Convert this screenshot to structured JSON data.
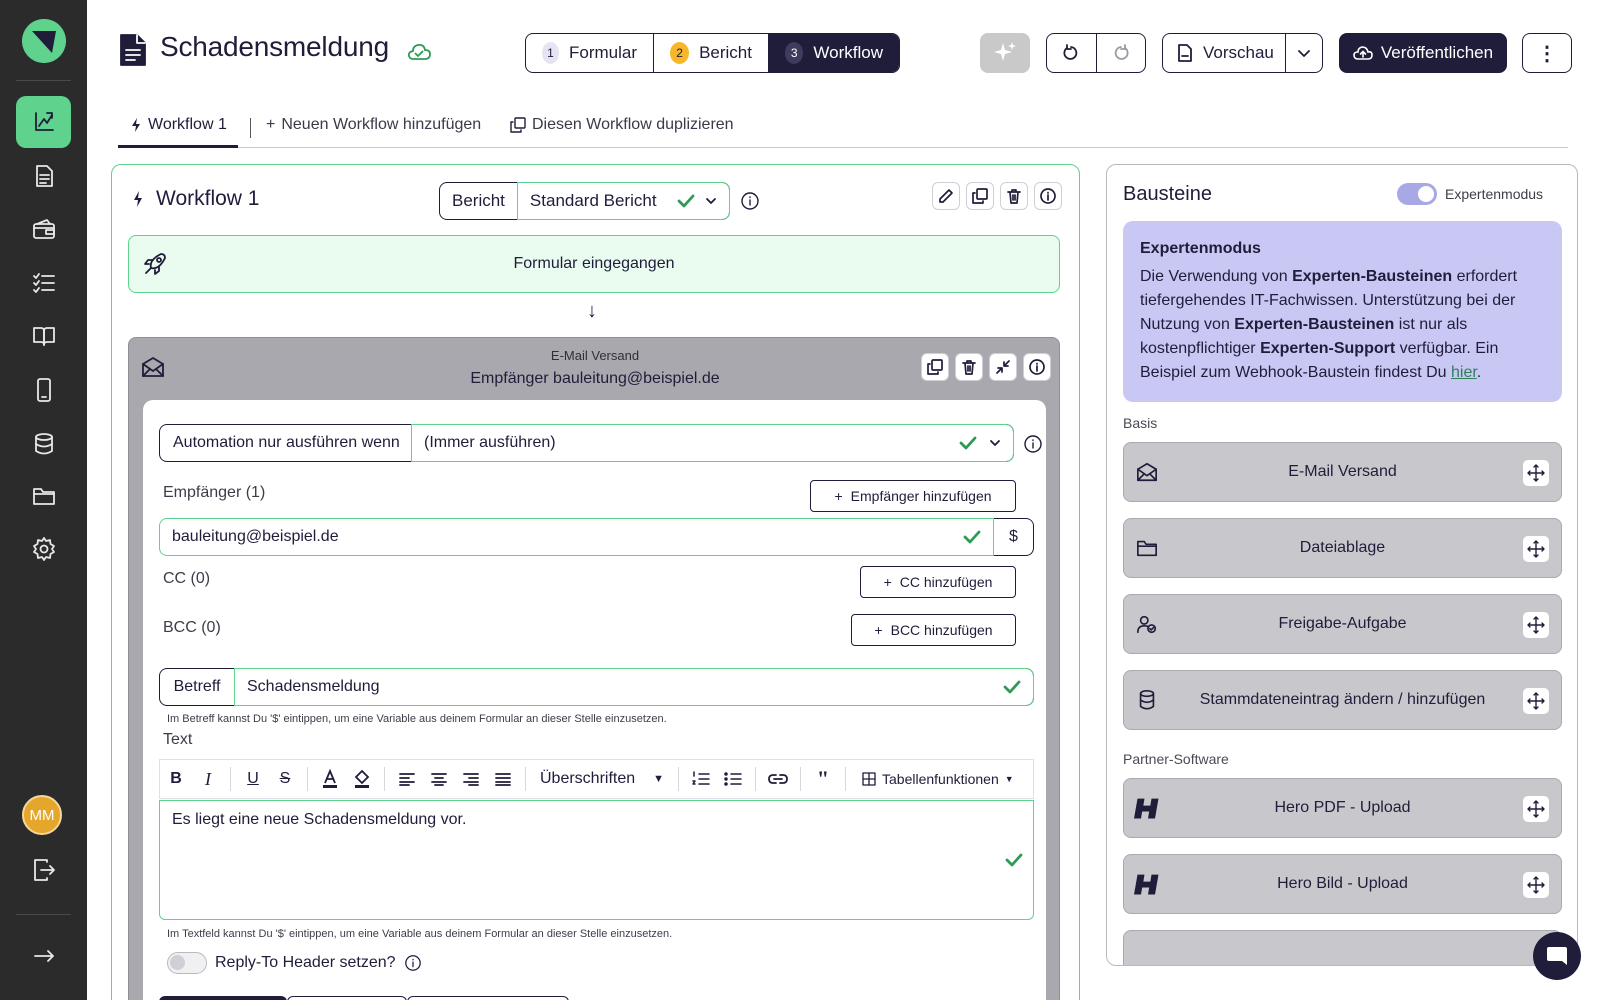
{
  "header": {
    "title": "Schadensmeldung",
    "steps": [
      {
        "num": "1",
        "label": "Formular"
      },
      {
        "num": "2",
        "label": "Bericht"
      },
      {
        "num": "3",
        "label": "Workflow"
      }
    ],
    "preview_label": "Vorschau",
    "publish_label": "Veröffentlichen",
    "more_label": "⋮"
  },
  "sidebar": {
    "items": [
      "workflow-icon",
      "document-icon",
      "wallet-icon",
      "checklist-icon",
      "book-icon",
      "phone-icon",
      "database-icon",
      "folder-icon",
      "gear-icon"
    ],
    "avatar_initials": "MM"
  },
  "tabs": {
    "workflow1": "Workflow 1",
    "add": "Neuen Workflow hinzufügen",
    "duplicate": "Diesen Workflow duplizieren"
  },
  "workflow": {
    "title": "Workflow 1",
    "report_label": "Bericht",
    "report_value": "Standard Bericht",
    "trigger": "Formular eingegangen",
    "arrow": "↓",
    "email": {
      "type": "E-Mail Versand",
      "summary": "Empfänger bauleitung@beispiel.de",
      "automation_label": "Automation nur ausführen wenn",
      "automation_value": "(Immer ausführen)",
      "recipients_label": "Empfänger (1)",
      "add_recipient": "Empfänger hinzufügen",
      "recipient": "bauleitung@beispiel.de",
      "dollar": "$",
      "cc_label": "CC (0)",
      "add_cc": "CC hinzufügen",
      "bcc_label": "BCC (0)",
      "add_bcc": "BCC hinzufügen",
      "subject_label": "Betreff",
      "subject_value": "Schadensmeldung",
      "subject_hint": "Im Betreff kannst Du '$' eintippen, um eine Variable aus deinem Formular an dieser Stelle einzusetzen.",
      "text_label": "Text",
      "toolbar_headings": "Überschriften",
      "toolbar_table": "Tabellenfunktionen",
      "body_text": "Es liegt eine neue Schadensmeldung vor.",
      "text_hint": "Im Textfeld kannst Du '$' eintippen, um eine Variable aus deinem Formular an dieser Stelle einzusetzen.",
      "reply_to": "Reply-To Header setzen?"
    }
  },
  "bausteine": {
    "title": "Bausteine",
    "expert_toggle": "Expertenmodus",
    "expert_box": {
      "heading": "Expertenmodus",
      "t1": "Die Verwendung von ",
      "b1": "Experten-Bausteinen",
      "t2": " erfordert tiefergehendes IT-Fachwissen. Unterstützung bei der Nutzung von ",
      "b2": "Experten-Bausteinen",
      "t3": " ist nur als kostenpflichtiger ",
      "b3": "Experten-Support",
      "t4": " verfügbar. Ein Beispiel zum Webhook-Baustein findest Du ",
      "link": "hier",
      "t5": "."
    },
    "basis_label": "Basis",
    "basis_items": [
      "E-Mail Versand",
      "Dateiablage",
      "Freigabe-Aufgabe",
      "Stammdateneintrag ändern / hinzufügen"
    ],
    "partner_label": "Partner-Software",
    "partner_items": [
      "Hero PDF - Upload",
      "Hero Bild - Upload"
    ]
  },
  "colors": {
    "accent_green": "#5fd38d",
    "primary_dark": "#1f1d3a",
    "expert_purple": "#c9c8f4"
  }
}
